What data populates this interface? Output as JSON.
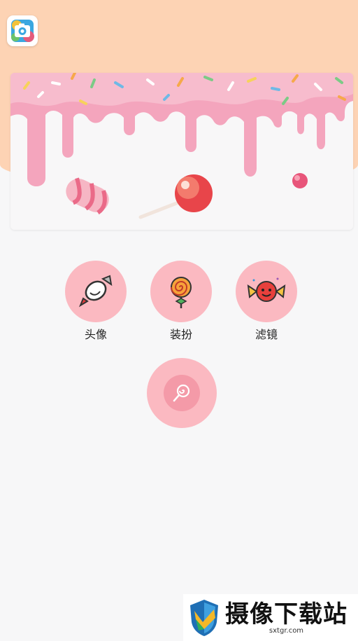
{
  "app": {
    "icon": "camera-app-icon"
  },
  "banner": {
    "image": "dripping-candy-icing-banner"
  },
  "menu": [
    {
      "label": "头像",
      "icon": "wrapped-candy-icon"
    },
    {
      "label": "装扮",
      "icon": "lollipop-icon"
    },
    {
      "label": "滤镜",
      "icon": "candy-face-icon"
    }
  ],
  "fab": {
    "icon": "lollipop-swirl-icon"
  },
  "watermark": {
    "title": "摄像下载站",
    "url": "sxtgr.com"
  },
  "colors": {
    "top": "#fdd3b4",
    "circle": "#fbb9c1",
    "background": "#f7f7f8"
  }
}
